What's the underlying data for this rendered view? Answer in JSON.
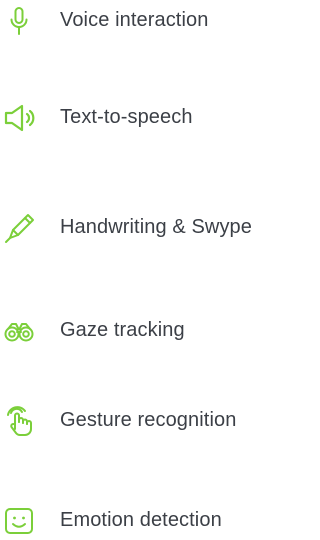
{
  "colors": {
    "icon_accent": "#7bcf3a",
    "label_text": "#3b3f46",
    "background": "#ffffff"
  },
  "features": [
    {
      "label": "Voice interaction",
      "icon": "microphone-icon"
    },
    {
      "label": "Text-to-speech",
      "icon": "speaker-icon"
    },
    {
      "label": "Handwriting & Swype",
      "icon": "pen-icon"
    },
    {
      "label": "Gaze tracking",
      "icon": "binoculars-icon"
    },
    {
      "label": "Gesture recognition",
      "icon": "hand-pointer-icon"
    },
    {
      "label": "Emotion detection",
      "icon": "smiley-face-icon"
    }
  ]
}
